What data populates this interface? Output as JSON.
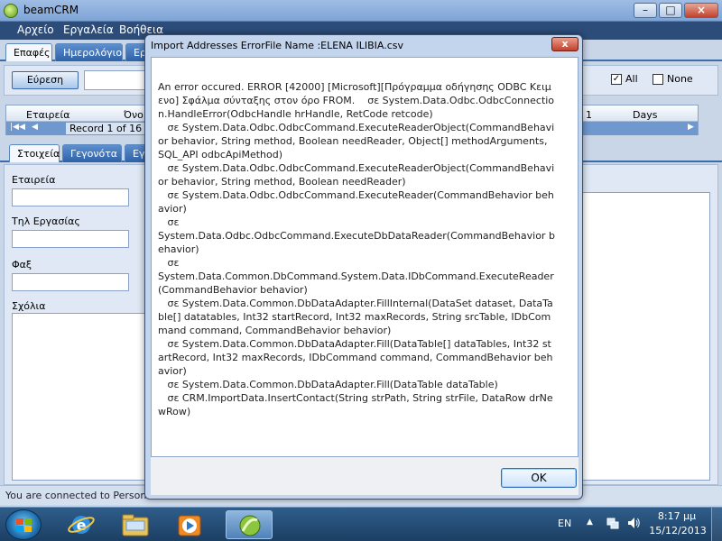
{
  "app": {
    "title": "beamCRM",
    "menu": [
      "Αρχείο",
      "Εργαλεία",
      "Βοήθεια"
    ],
    "top_tabs": [
      "Επαφές",
      "Ημερολόγιο",
      "Ερ"
    ],
    "find_button": "Εύρεση",
    "filter_all": "All",
    "filter_none": "None",
    "grid": {
      "col_company": "Εταιρεία",
      "col_name": "Όνο",
      "col_num": "1",
      "col_days": "Days",
      "record_label": "Record 1 of 16"
    },
    "detail_tabs": [
      "Στοιχεία",
      "Γεγονότα",
      "Εγ"
    ],
    "fields": {
      "company": "Εταιρεία",
      "work_phone": "Τηλ Εργασίας",
      "fax": "Φαξ",
      "notes": "Σχόλια"
    },
    "status": "You are connected to Person"
  },
  "dialog": {
    "title": "Import Addresses ErrorFile Name :ELENA ILIBIA.csv",
    "close_label": "x",
    "message": "An error occured. ERROR [42000] [Microsoft][Πρόγραμμα οδήγησης ODBC Κειμενο] Σφάλμα σύνταξης στον όρο FROM.    σε System.Data.Odbc.OdbcConnection.HandleError(OdbcHandle hrHandle, RetCode retcode)\n   σε System.Data.Odbc.OdbcCommand.ExecuteReaderObject(CommandBehavior behavior, String method, Boolean needReader, Object[] methodArguments, SQL_API odbcApiMethod)\n   σε System.Data.Odbc.OdbcCommand.ExecuteReaderObject(CommandBehavior behavior, String method, Boolean needReader)\n   σε System.Data.Odbc.OdbcCommand.ExecuteReader(CommandBehavior behavior)\n   σε\nSystem.Data.Odbc.OdbcCommand.ExecuteDbDataReader(CommandBehavior behavior)\n   σε\nSystem.Data.Common.DbCommand.System.Data.IDbCommand.ExecuteReader(CommandBehavior behavior)\n   σε System.Data.Common.DbDataAdapter.FillInternal(DataSet dataset, DataTable[] datatables, Int32 startRecord, Int32 maxRecords, String srcTable, IDbCommand command, CommandBehavior behavior)\n   σε System.Data.Common.DbDataAdapter.Fill(DataTable[] dataTables, Int32 startRecord, Int32 maxRecords, IDbCommand command, CommandBehavior behavior)\n   σε System.Data.Common.DbDataAdapter.Fill(DataTable dataTable)\n   σε CRM.ImportData.InsertContact(String strPath, String strFile, DataRow drNewRow)",
    "ok_label": "OK"
  },
  "taskbar": {
    "language": "EN",
    "time": "8:17 μμ",
    "date": "15/12/2013"
  },
  "colors": {
    "accent": "#2c4d7a",
    "tab_active": "#f4f7fb",
    "close_red": "#c2402a",
    "taskbar": "#1c3f63"
  }
}
